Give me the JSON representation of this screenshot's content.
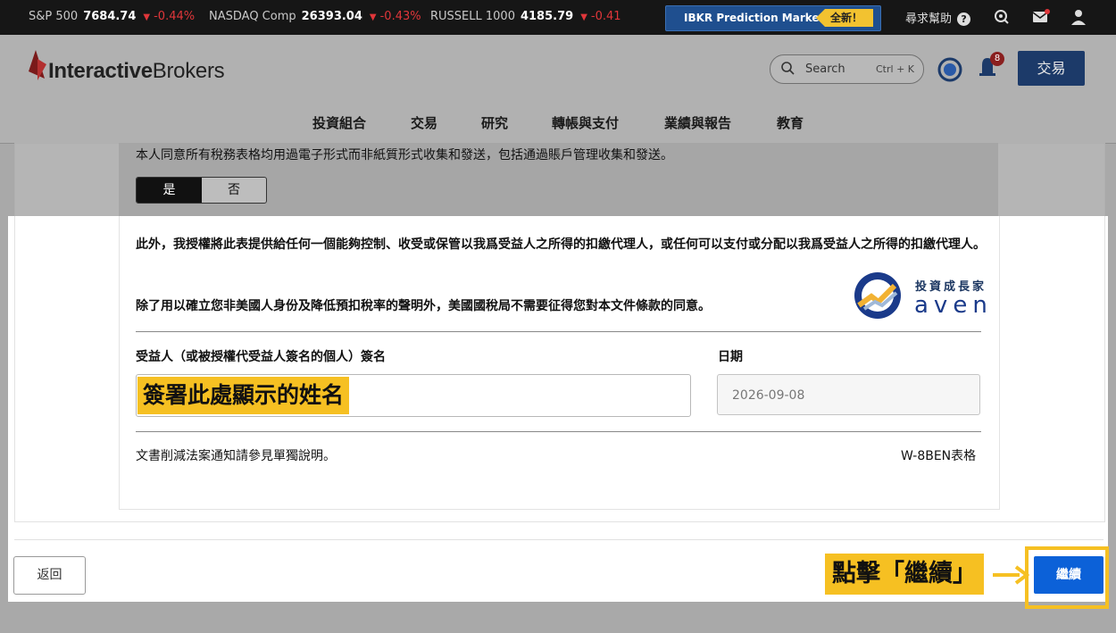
{
  "ticker": {
    "items": [
      {
        "name": "S&P 500",
        "value": "7684.74",
        "change": "-0.44%"
      },
      {
        "name": "NASDAQ Comp",
        "value": "26393.04",
        "change": "-0.43%"
      },
      {
        "name": "RUSSELL 1000",
        "value": "4185.79",
        "change": "-0.41"
      }
    ],
    "down_arrow": "▼",
    "prediction_markets": "IBKR Prediction Markets",
    "new_badge": "全新！",
    "help_label": "尋求幫助",
    "help_icon": "?"
  },
  "header": {
    "logo_bold": "Interactive",
    "logo_rest": "Brokers",
    "search_label": "Search",
    "search_shortcut": "Ctrl + K",
    "notification_count": "8",
    "trade_button": "交易",
    "nav": [
      "投資組合",
      "交易",
      "研究",
      "轉帳與支付",
      "業績與報告",
      "教育"
    ]
  },
  "form": {
    "consent_text": "本人同意所有稅務表格均用過電子形式而非紙質形式收集和發送，包括通過賬戶管理收集和發送。",
    "yes_label": "是",
    "no_label": "否",
    "paragraph1": "此外，我授權將此表提供給任何一個能夠控制、收受或保管以我爲受益人之所得的扣繳代理人，或任何可以支付或分配以我爲受益人之所得的扣繳代理人。",
    "paragraph2": "除了用以確立您非美國人身份及降低預扣稅率的聲明外，美國國稅局不需要征得您對本文件條款的同意。",
    "signature_label": "受益人（或被授權代受益人簽名的個人）簽名",
    "date_label": "日期",
    "signature_note": "簽署此處顯示的姓名",
    "date_value": "2026-09-08",
    "footer_left": "文書削減法案通知請參見單獨說明。",
    "footer_right": "W-8BEN表格"
  },
  "watermark": {
    "cn": "投資成長家",
    "en": "aven"
  },
  "actions": {
    "back_button": "返回",
    "click_note": "點擊「繼續」",
    "continue_button": "繼續"
  },
  "colors": {
    "accent_blue": "#0c61d8",
    "highlight_yellow": "#f6c022",
    "ticker_bg": "#161616",
    "down_red": "#e0363a"
  }
}
